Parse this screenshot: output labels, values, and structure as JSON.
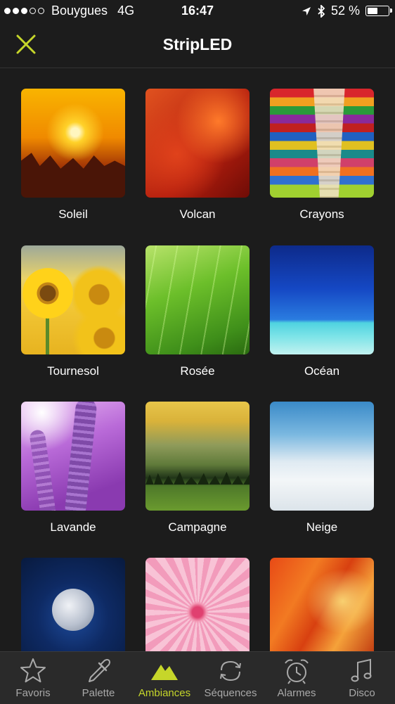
{
  "status_bar": {
    "carrier": "Bouygues",
    "network": "4G",
    "time": "16:47",
    "battery": "52 %",
    "battery_level": 0.52,
    "signal_bars_filled": 3,
    "signal_bars_total": 5
  },
  "nav": {
    "title": "StripLED",
    "close_icon": "close-icon",
    "accent": "#c6d62a"
  },
  "ambiances": [
    {
      "label": "Soleil",
      "image": "sunset-photo"
    },
    {
      "label": "Volcan",
      "image": "lava-photo"
    },
    {
      "label": "Crayons",
      "image": "colored-pencils-photo"
    },
    {
      "label": "Tournesol",
      "image": "sunflower-photo"
    },
    {
      "label": "Rosée",
      "image": "dewy-grass-photo"
    },
    {
      "label": "Océan",
      "image": "ocean-photo"
    },
    {
      "label": "Lavande",
      "image": "lavender-photo"
    },
    {
      "label": "Campagne",
      "image": "countryside-photo"
    },
    {
      "label": "Neige",
      "image": "snow-photo"
    },
    {
      "label": "",
      "image": "moon-photo"
    },
    {
      "label": "",
      "image": "pink-flower-photo"
    },
    {
      "label": "",
      "image": "canyon-photo"
    }
  ],
  "tabbar": {
    "active_tab": "Ambiances",
    "tabs": [
      {
        "label": "Favoris",
        "icon": "star-icon"
      },
      {
        "label": "Palette",
        "icon": "dropper-icon"
      },
      {
        "label": "Ambiances",
        "icon": "mountains-icon"
      },
      {
        "label": "Séquences",
        "icon": "repeat-icon"
      },
      {
        "label": "Alarmes",
        "icon": "alarm-clock-icon"
      },
      {
        "label": "Disco",
        "icon": "music-note-icon"
      }
    ]
  }
}
